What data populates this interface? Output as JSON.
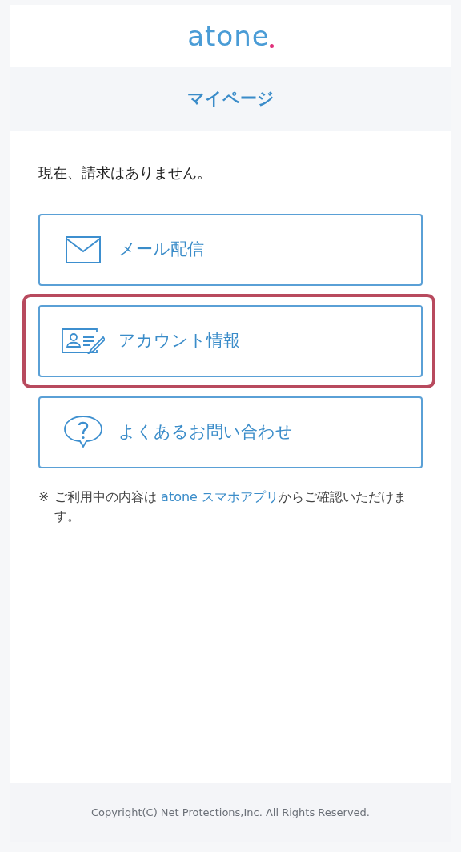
{
  "header": {
    "logo": "atone"
  },
  "page_title": "マイページ",
  "message": "現在、請求はありません。",
  "menu": [
    {
      "kind": "mail",
      "label": "メール配信",
      "highlighted": false
    },
    {
      "kind": "account",
      "label": "アカウント情報",
      "highlighted": true
    },
    {
      "kind": "help",
      "label": "よくあるお問い合わせ",
      "highlighted": false
    }
  ],
  "note": {
    "mark": "※",
    "before": "ご利用中の内容は ",
    "link": "atone スマホアプリ",
    "after": "からご確認いただけます。"
  },
  "footer": {
    "copyright": "Copyright(C) Net Protections,Inc. All Rights Reserved."
  }
}
